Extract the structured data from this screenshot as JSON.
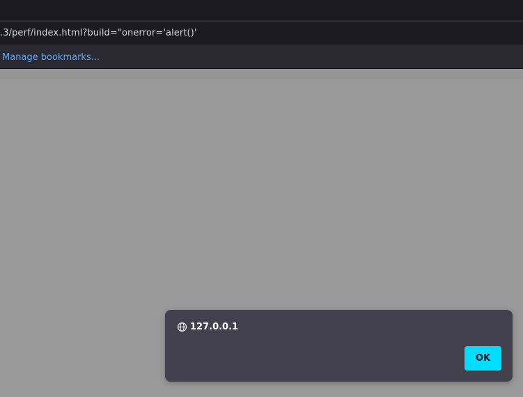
{
  "browser": {
    "url_text": ".3/perf/index.html?build=\"onerror='alert()'",
    "bookmarks_bar": {
      "manage_label": "Manage bookmarks..."
    }
  },
  "dialog": {
    "origin_icon": "globe-icon",
    "origin": "127.0.0.1",
    "ok_label": "OK"
  },
  "colors": {
    "toolbar_bg": "#1c1b22",
    "bookmarks_bg": "#2b2a33",
    "link": "#5ea8f5",
    "content_dimmed": "#999999",
    "dialog_bg": "#42414d",
    "accent_button": "#00ddff"
  }
}
